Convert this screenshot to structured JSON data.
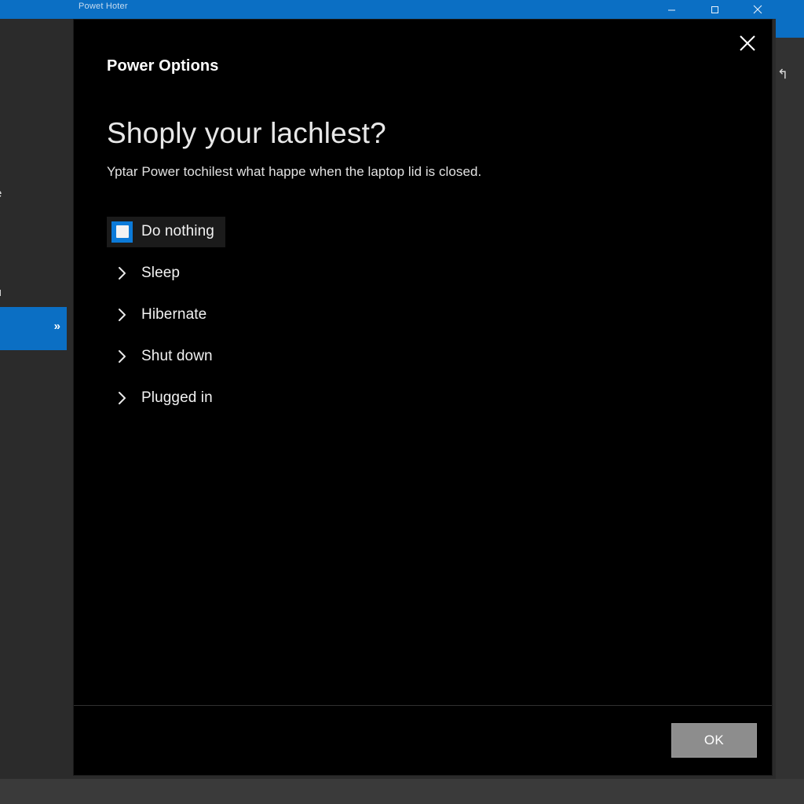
{
  "window": {
    "title": "Powet Hoter",
    "controls": {
      "minimize": "minimize-button",
      "maximize": "maximize-button",
      "close": "close-button"
    },
    "accent_color": "#0b6fc4",
    "panel_color": "#2b2b2b",
    "desktop_color": "#393939"
  },
  "background": {
    "left_fragment_1": "e",
    "left_fragment_2": "tı",
    "selected_row_chevron": "»",
    "right_glyph": "↰"
  },
  "dialog": {
    "app_title": "Power Options",
    "heading": "Shoply your lachlest?",
    "subtitle": "Yptar Power tochilest what happe when the laptop lid is closed.",
    "close_label": "Close",
    "background_color": "#000000",
    "selected_color": "#0b7ad8",
    "options": [
      {
        "label": "Do nothing",
        "selected": true,
        "icon": "checkbox-filled-icon"
      },
      {
        "label": "Sleep",
        "selected": false,
        "icon": "chevron-right-icon"
      },
      {
        "label": "Hibernate",
        "selected": false,
        "icon": "chevron-right-icon"
      },
      {
        "label": "Shut down",
        "selected": false,
        "icon": "chevron-right-icon"
      },
      {
        "label": "Plugged in",
        "selected": false,
        "icon": "chevron-right-icon"
      }
    ],
    "footer": {
      "ok_label": "OK"
    }
  }
}
